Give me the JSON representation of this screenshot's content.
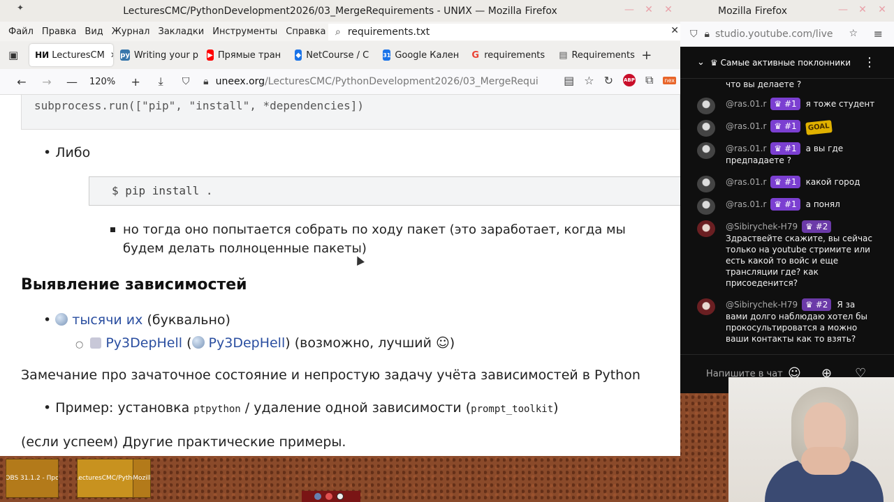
{
  "left_window": {
    "title": "LecturesCMC/PythonDevelopment2026/03_MergeRequirements - UNИX — Mozilla Firefox",
    "menu": [
      "Файл",
      "Правка",
      "Вид",
      "Журнал",
      "Закладки",
      "Инструменты",
      "Справка"
    ],
    "find_value": "requirements.txt",
    "tabs": [
      {
        "label": "LecturesCM",
        "favicon": "НИ",
        "color": "#222222",
        "active": true
      },
      {
        "label": "Writing your p",
        "favicon": "py",
        "color": "#3776ab"
      },
      {
        "label": "Прямые тран",
        "favicon": "▶",
        "color": "#ff0000"
      },
      {
        "label": "NetCourse / C",
        "favicon": "◆",
        "color": "#1a73e8"
      },
      {
        "label": "Google Кален",
        "favicon": "31",
        "color": "#1a73e8"
      },
      {
        "label": "requirements",
        "favicon": "G",
        "color": "#ea4335"
      },
      {
        "label": "Requirements",
        "favicon": "▤",
        "color": "#555555"
      }
    ],
    "zoom": "120%",
    "url_host": "uneex.org",
    "url_path": "/LecturesCMC/PythonDevelopment2026/03_MergeRequi",
    "content": {
      "code_top": "subprocess.run([\"pip\", \"install\", *dependencies])",
      "either": "Либо",
      "code_pip": "$ pip install .",
      "note": "но тогда оно попытается собрать по ходу пакет (это заработает, когда мы будем делать полноценные пакеты)",
      "heading": "Выявление зависимостей",
      "thousands_link": "тысячи их",
      "thousands_rest": "(буквально)",
      "py3dep_link1": "Py3DepHell",
      "py3dep_open": "(",
      "py3dep_link2": "Py3DepHell",
      "py3dep_rest": ") (возможно, лучший ☺)",
      "remark": "Замечание про зачаточное состояние и непростую задачу учёта зависимостей в Python",
      "example_prefix": "Пример: установка",
      "example_code1": "ptpython",
      "example_mid": "/ удаление одной зависимости (",
      "example_code2": "prompt_toolkit",
      "example_end": ")",
      "if_time": "(если успеем) Другие практические примеры."
    }
  },
  "right_window": {
    "title": "Mozilla Firefox",
    "url": "studio.youtube.com/live",
    "chat_filter": "Самые активные поклонники",
    "messages": [
      {
        "author": "",
        "badge": "",
        "text": "что вы делаете ?"
      },
      {
        "author": "@ras.01.r",
        "badge": "#1",
        "text": "я тоже студент"
      },
      {
        "author": "@ras.01.r",
        "badge": "#1",
        "text": "GOAL"
      },
      {
        "author": "@ras.01.r",
        "badge": "#1",
        "text": "а вы где предпадаете ?"
      },
      {
        "author": "@ras.01.r",
        "badge": "#1",
        "text": "какой город"
      },
      {
        "author": "@ras.01.r",
        "badge": "#1",
        "text": "а понял"
      },
      {
        "author": "@Sibirychek-H79",
        "badge": "#2",
        "text": "Здраствейте скажите, вы сейчас только на youtube стримите или есть какой то войс и еще трансляции где? как присоеденится?"
      },
      {
        "author": "@Sibirychek-H79",
        "badge": "#2",
        "text": "Я за вами долго наблюдаю хотел бы прокосультироватся а можно ваши контакты как то взять?"
      }
    ],
    "chat_placeholder": "Напишите в чат"
  },
  "taskbar": {
    "tasks": [
      "OBS 31.1.2 - Про",
      "LecturesCMC/Pytho",
      "Mozill"
    ]
  },
  "colors": {
    "badge": "#7b3fd1",
    "link": "#2a4ea0",
    "chat_bg": "#0f0f0f"
  }
}
